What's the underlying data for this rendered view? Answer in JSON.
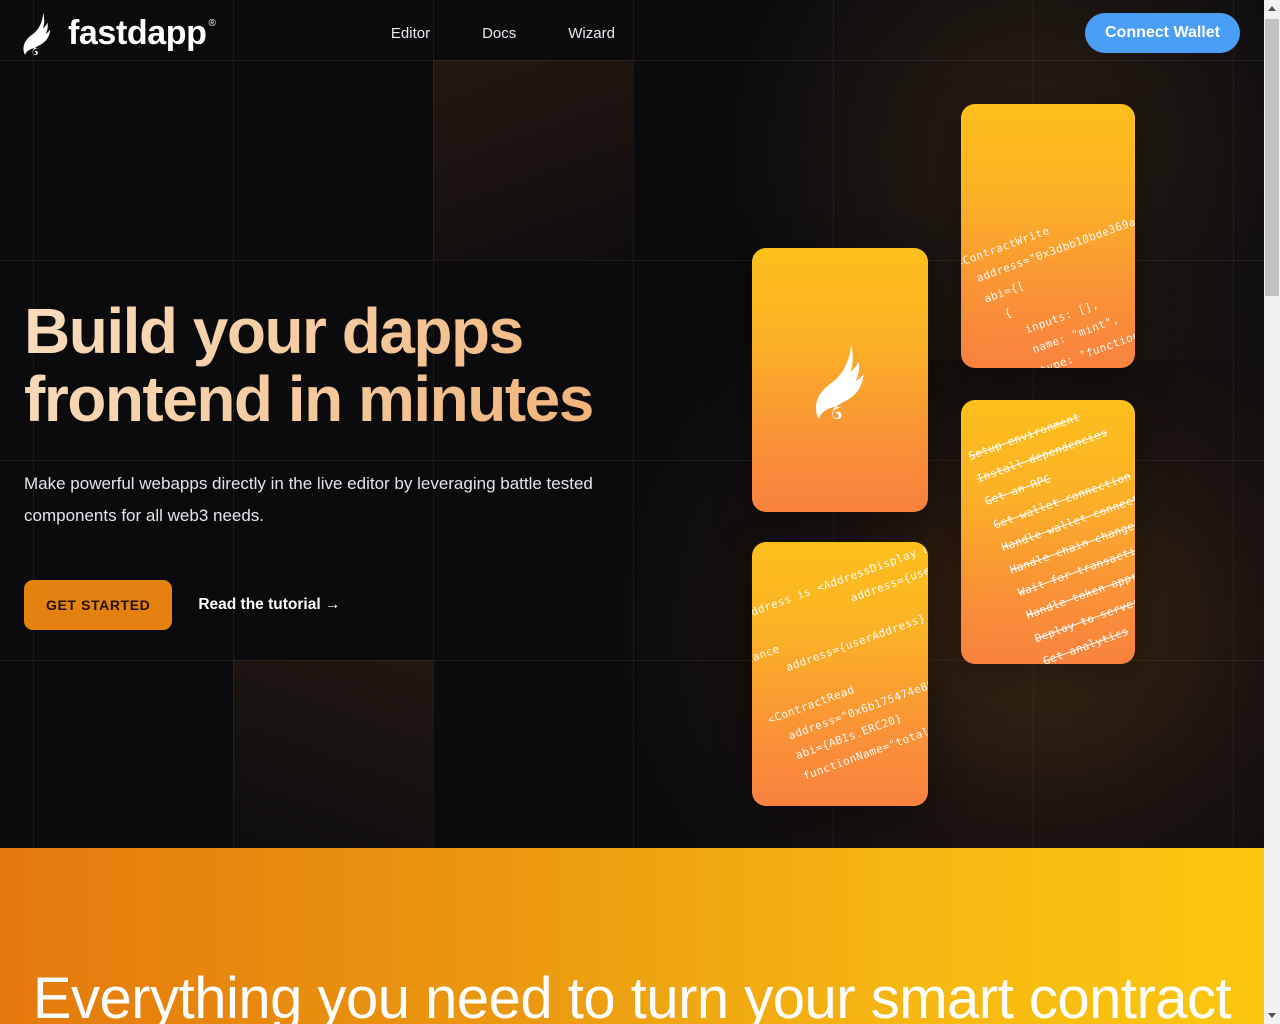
{
  "nav": {
    "brand": {
      "name": "fastdapp",
      "trademark": "®",
      "logo_icon": "feather-flame-icon"
    },
    "links": [
      {
        "label": "Editor"
      },
      {
        "label": "Docs"
      },
      {
        "label": "Wizard"
      }
    ],
    "connect_button": {
      "label": "Connect Wallet",
      "color": "#4a9ef5"
    }
  },
  "hero": {
    "headline": "Build your dapps frontend in minutes",
    "subhead": "Make powerful webapps directly in the live editor by leveraging battle tested components for all web3 needs.",
    "primary_cta": {
      "label": "GET STARTED",
      "color": "#e5820f"
    },
    "secondary_cta": {
      "label": "Read the tutorial →"
    },
    "headline_gradient": [
      "#f9dcbc",
      "#efab6b"
    ]
  },
  "cards": {
    "contract_write": {
      "icon_name": "code-card",
      "code": "<ContractWrite\n  address=\"0x3dbb10bde369a8272\n  abi={[\n    {\n      inputs: [],\n      name: \"mint\",\n      type: \"function\n    },\n  ]}\n  functionName=\"mint\"\n  buttonText=\"Mint an\n\n/>",
      "gradient": [
        "#fcbf1b",
        "#f9823f"
      ]
    },
    "logo_card": {
      "icon_name": "feather-flame-icon",
      "gradient": [
        "#fcbf1b",
        "#f9823f"
      ]
    },
    "checklist": {
      "items": [
        "Setup environment",
        "Install dependencies",
        "Get an RPC",
        "Get wallet connection",
        "Handle wallet connection",
        "Handle chain changes",
        "Wait for transactions",
        "Handle token approvals",
        "Deploy to server",
        "Get analytics"
      ],
      "gradient": [
        "#fcbf1b",
        "#f9823f"
      ]
    },
    "contract_read": {
      "icon_name": "code-card",
      "code": "  address is <AddressDisplay addr\n                 address={userAddress} />.\nlance\n     address={userAddress}\n\n<ContractRead\n  address=\"0x6b175474e89094c4\n  abi={ABIs.ERC20}\n  functionName=\"totalSupply\"\n\n\n  />",
      "gradient": [
        "#fcbf1b",
        "#f9823f"
      ]
    }
  },
  "band": {
    "title": "Everything you need to turn your smart contract",
    "gradient": [
      "#e4790c",
      "#fbc70f"
    ]
  },
  "scrollbar": {
    "up_arrow_icon": "triangle-up-icon",
    "down_arrow_icon": "triangle-down-icon"
  }
}
